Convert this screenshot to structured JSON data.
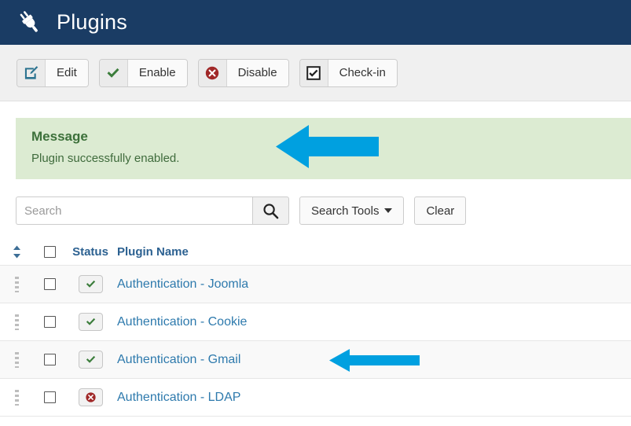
{
  "header": {
    "title": "Plugins",
    "icon": "plug-icon",
    "bg_color": "#1a3c64"
  },
  "toolbar": {
    "buttons": [
      {
        "label": "Edit",
        "icon": "edit-pencil-square-icon",
        "icon_color": "#2c7390"
      },
      {
        "label": "Enable",
        "icon": "check-icon",
        "icon_color": "#3b7d3b"
      },
      {
        "label": "Disable",
        "icon": "circle-x-icon",
        "icon_color": "#a02828"
      },
      {
        "label": "Check-in",
        "icon": "checkbox-checked-icon",
        "icon_color": "#222222"
      }
    ]
  },
  "message": {
    "title": "Message",
    "text": "Plugin successfully enabled.",
    "bg_color": "#dcebd2",
    "text_color": "#3c703a"
  },
  "search": {
    "placeholder": "Search",
    "value": "",
    "submit_icon": "search-icon",
    "search_tools_label": "Search Tools",
    "clear_label": "Clear"
  },
  "table": {
    "columns": {
      "sort_icon": "sort-updown-icon",
      "select_all": "select-all-checkbox",
      "status": "Status",
      "plugin_name": "Plugin Name"
    },
    "rows": [
      {
        "name": "Authentication - Joomla",
        "status": "enabled",
        "status_icon": "check-icon",
        "checked": false,
        "stripe": "odd"
      },
      {
        "name": "Authentication - Cookie",
        "status": "enabled",
        "status_icon": "check-icon",
        "checked": false,
        "stripe": "even"
      },
      {
        "name": "Authentication - Gmail",
        "status": "enabled",
        "status_icon": "check-icon",
        "checked": false,
        "stripe": "odd"
      },
      {
        "name": "Authentication - LDAP",
        "status": "disabled",
        "status_icon": "circle-x-icon",
        "checked": false,
        "stripe": "even"
      }
    ]
  },
  "annotations": {
    "arrow_color": "#00a0e0",
    "message_arrow": "left-pointing-arrow",
    "row_arrow": "left-pointing-arrow"
  }
}
